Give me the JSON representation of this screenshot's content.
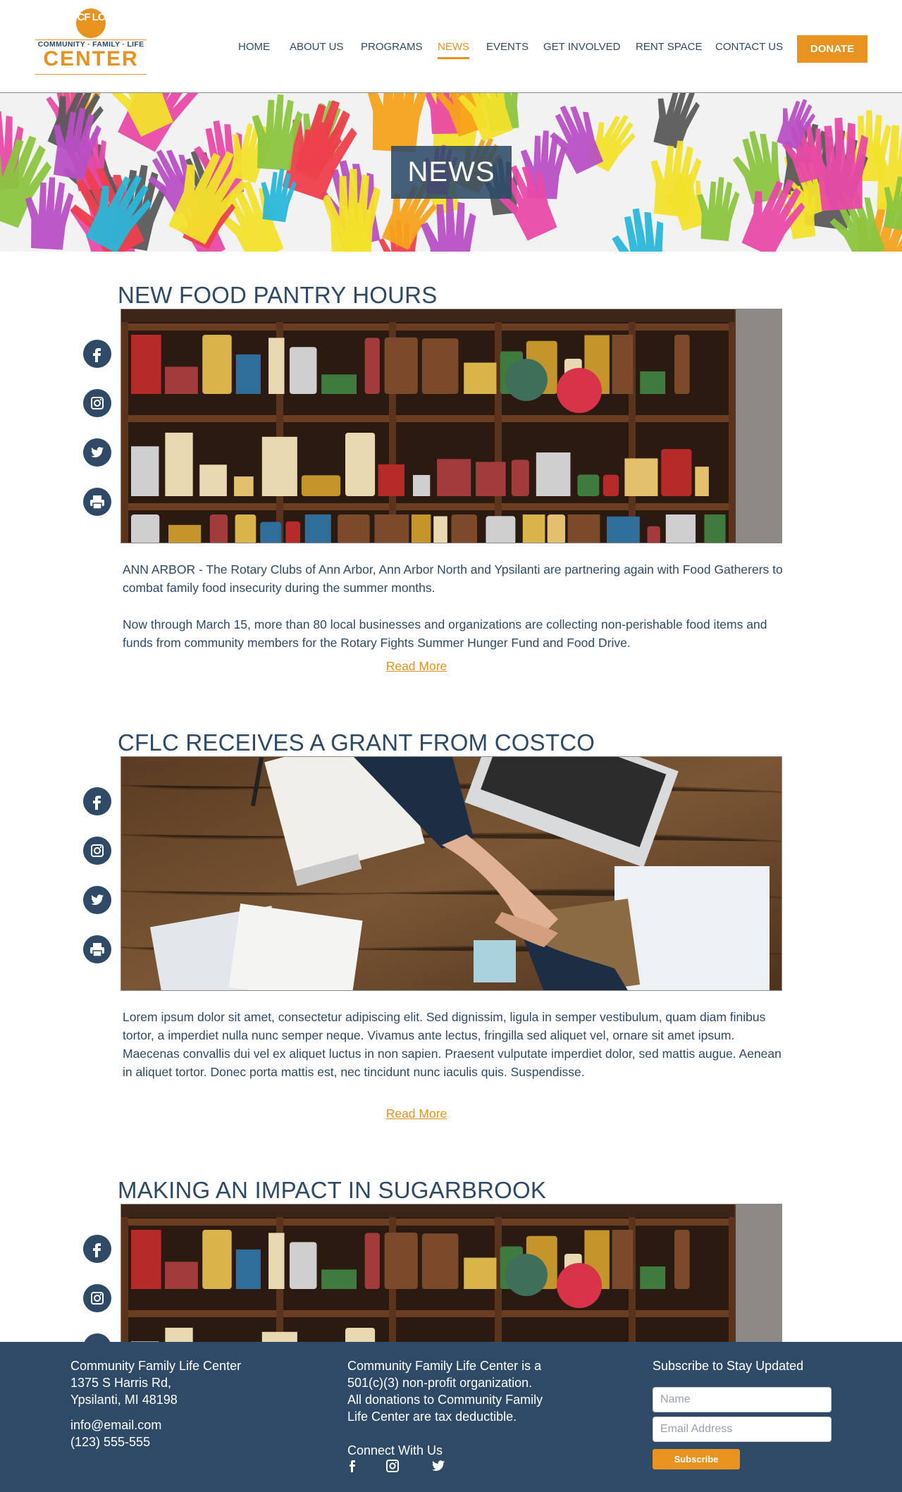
{
  "header": {
    "logo": {
      "monogram": "CF LC",
      "tagline": "COMMUNITY · FAMILY · LIFE",
      "wordmark": "CENTER"
    },
    "nav": [
      {
        "label": "HOME",
        "active": false
      },
      {
        "label": "ABOUT US",
        "active": false
      },
      {
        "label": "PROGRAMS",
        "active": false
      },
      {
        "label": "NEWS",
        "active": true
      },
      {
        "label": "EVENTS",
        "active": false
      },
      {
        "label": "GET INVOLVED",
        "active": false
      },
      {
        "label": "RENT SPACE",
        "active": false
      },
      {
        "label": "CONTACT US",
        "active": false
      }
    ],
    "donate_label": "DONATE"
  },
  "hero": {
    "title": "NEWS"
  },
  "share_icons": [
    "facebook-icon",
    "instagram-icon",
    "twitter-icon",
    "print-icon"
  ],
  "articles": [
    {
      "title": "NEW FOOD PANTRY HOURS",
      "image": "pantry-shelves",
      "paragraphs": [
        "ANN ARBOR - The Rotary Clubs of Ann Arbor, Ann Arbor North and Ypsilanti are partnering again with Food Gatherers to combat family food insecurity during the summer months.",
        "Now through March 15, more than 80 local businesses and organizations are collecting non-perishable food items and funds from community members for the Rotary Fights Summer Hunger Fund and Food Drive."
      ],
      "read_more": "Read More"
    },
    {
      "title": "CFLC RECEIVES A GRANT FROM COSTCO",
      "image": "handshake-desk",
      "paragraphs": [
        "Lorem ipsum dolor sit amet, consectetur adipiscing elit. Sed dignissim, ligula in semper vestibulum, quam diam finibus tortor, a imperdiet nulla nunc semper neque. Vivamus ante lectus, fringilla sed aliquet vel, ornare sit amet ipsum. Maecenas convallis dui vel ex aliquet luctus in non sapien. Praesent vulputate imperdiet dolor, sed mattis augue. Aenean in aliquet tortor. Donec porta mattis est, nec tincidunt nunc iaculis quis. Suspendisse."
      ],
      "read_more": "Read More"
    },
    {
      "title": "MAKING AN IMPACT IN SUGARBROOK",
      "image": "pantry-shelves"
    }
  ],
  "footer": {
    "address": [
      "Community Family Life Center",
      "1375 S Harris Rd,",
      "Ypsilanti, MI 48198"
    ],
    "email": "info@email.com",
    "phone": "(123) 555-555",
    "about": [
      "Community Family Life Center is a",
      "501(c)(3) non-profit organization.",
      "All donations to Community Family",
      "Life Center are tax deductible."
    ],
    "connect_label": "Connect With Us",
    "social_icons": [
      "facebook-icon",
      "instagram-icon",
      "twitter-icon"
    ],
    "subscribe": {
      "title": "Subscribe to Stay Updated",
      "name_placeholder": "Name",
      "email_placeholder": "Email Address",
      "button": "Subscribe"
    }
  },
  "colors": {
    "primary": "#2e4a66",
    "accent": "#e8921f",
    "footer_bg": "#2e4a66"
  }
}
